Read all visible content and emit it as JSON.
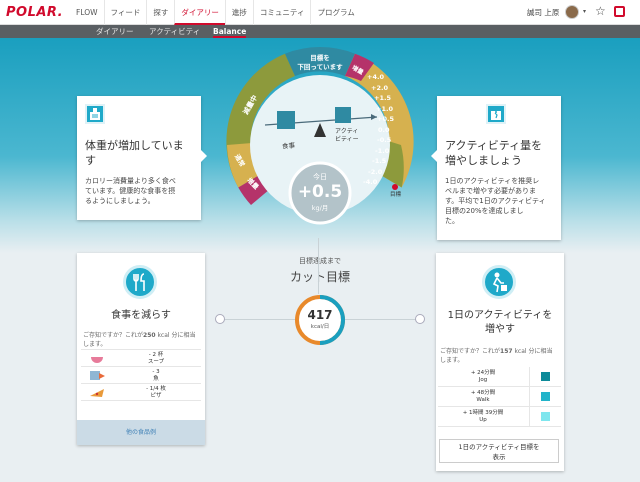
{
  "topnav": {
    "logo": "POLAR.",
    "items": [
      "FLOW",
      "フィード",
      "探す",
      "ダイアリー",
      "進捗",
      "コミュニティ",
      "プログラム"
    ],
    "active_index": 3,
    "user_name": "誠司 上原",
    "caret": "▾",
    "star": "☆"
  },
  "subnav": {
    "items": [
      "ダイアリー",
      "アクティビティ",
      "Balance"
    ],
    "active_index": 2
  },
  "left_card": {
    "title_line1": "体重が増加していま",
    "title_line2": "す",
    "body": [
      "カロリー消費量より多く食べ",
      "ています。健康的な食事を摂",
      "るようにしましょう。"
    ]
  },
  "right_card": {
    "title_line1": "アクティビティ量を",
    "title_line2": "増やしましょう",
    "body": [
      "1日のアクティビティを推奨レ",
      "ベルまで増やす必要がありま",
      "す。平均で1日のアクティビティ",
      "目標の20%を達成しまし",
      "た。"
    ]
  },
  "gauge": {
    "top_label_line1": "目標を",
    "top_label_line2": "下回っています",
    "left_label_1": "減量中",
    "left_label_2": "通常",
    "left_label_3": "増量",
    "right_upper_label": "増量",
    "scale": [
      "+4.0",
      "+2.0",
      "+1.5",
      "+1.0",
      "+0.5",
      "0.0",
      "-0.5",
      "-1.0",
      "-1.5",
      "-2.0",
      "-4.0"
    ],
    "food_label": "食事",
    "activity_label": "アクティビティー",
    "goal_label": "目標",
    "today_label": "今日",
    "today_value": "+0.5",
    "today_unit": "kg/月",
    "colors": {
      "olive": "#8d9a3c",
      "gold": "#d6b14f",
      "magenta": "#b5336a",
      "needle": "#4a6a7a"
    }
  },
  "center": {
    "subtitle": "目標達成まで",
    "title": "カット目標",
    "kcal_value": "417",
    "kcal_unit": "kcal/日"
  },
  "food_card": {
    "title": "食事を減らす",
    "didyouknow_pre": "ご存知ですか？これが",
    "didyouknow_bold": "250",
    "didyouknow_post": " kcal 分に相当",
    "didyouknow_line2": "します。",
    "rows": [
      {
        "amount": "- 2 杯",
        "name": "スープ"
      },
      {
        "amount": "- 3",
        "name": "魚"
      },
      {
        "amount": "- 1/4 枚",
        "name": "ピザ"
      }
    ],
    "footer": "他の食品例"
  },
  "activity_card": {
    "title_line1": "1日のアクティビティを",
    "title_line2": "増やす",
    "didyouknow_pre": "ご存知ですか？これが",
    "didyouknow_bold": "157",
    "didyouknow_post": " kcal 分に相当",
    "didyouknow_line2": "します。",
    "rows": [
      {
        "amount": "+ 24分間",
        "level": "Jog",
        "color": "#0d8a99"
      },
      {
        "amount": "+ 48分間",
        "level": "Walk",
        "color": "#22b3c9"
      },
      {
        "amount": "+ 1時間 39分間",
        "level": "Up",
        "color": "#7fe6ee"
      }
    ],
    "button_line1": "1日のアクティビティ目標を",
    "button_line2": "表示"
  }
}
